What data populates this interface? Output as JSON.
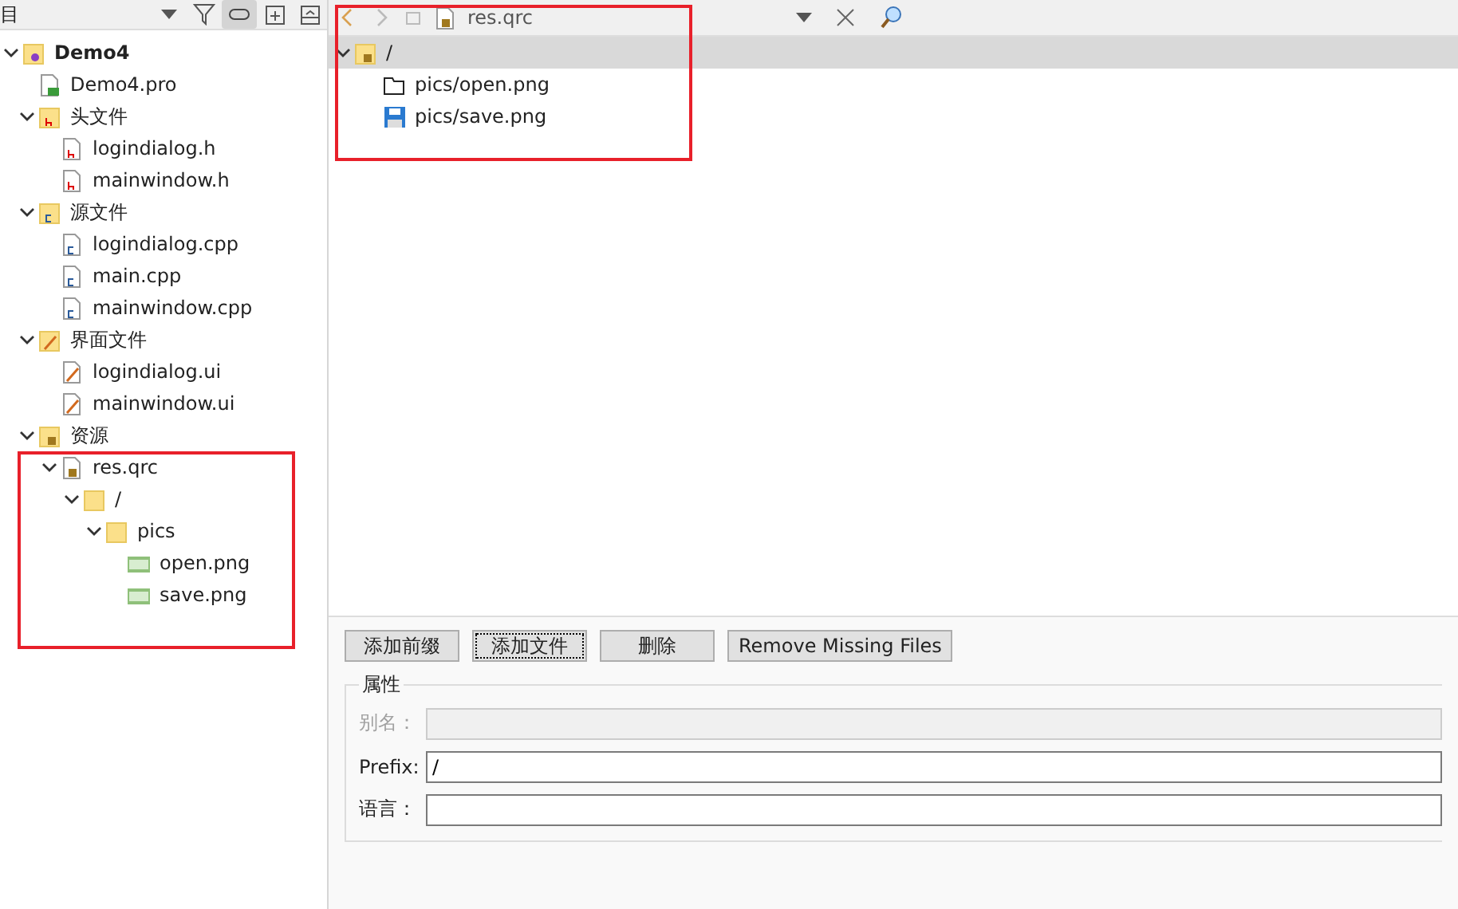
{
  "project_panel": {
    "title": "目",
    "tree": [
      {
        "label": "Demo4",
        "kind": "project",
        "expanded": true,
        "bold": true,
        "children": [
          {
            "label": "Demo4.pro",
            "kind": "pro"
          },
          {
            "label": "头文件",
            "kind": "folder-h",
            "expanded": true,
            "children": [
              {
                "label": "logindialog.h",
                "kind": "h"
              },
              {
                "label": "mainwindow.h",
                "kind": "h"
              }
            ]
          },
          {
            "label": "源文件",
            "kind": "folder-cpp",
            "expanded": true,
            "children": [
              {
                "label": "logindialog.cpp",
                "kind": "cpp"
              },
              {
                "label": "main.cpp",
                "kind": "cpp"
              },
              {
                "label": "mainwindow.cpp",
                "kind": "cpp"
              }
            ]
          },
          {
            "label": "界面文件",
            "kind": "folder-ui",
            "expanded": true,
            "children": [
              {
                "label": "logindialog.ui",
                "kind": "ui"
              },
              {
                "label": "mainwindow.ui",
                "kind": "ui"
              }
            ]
          },
          {
            "label": "资源",
            "kind": "folder-res",
            "expanded": true,
            "children": [
              {
                "label": "res.qrc",
                "kind": "qrc",
                "expanded": true,
                "children": [
                  {
                    "label": "/",
                    "kind": "folder",
                    "expanded": true,
                    "children": [
                      {
                        "label": "pics",
                        "kind": "folder",
                        "expanded": true,
                        "children": [
                          {
                            "label": "open.png",
                            "kind": "png"
                          },
                          {
                            "label": "save.png",
                            "kind": "png"
                          }
                        ]
                      }
                    ]
                  }
                ]
              }
            ]
          }
        ]
      }
    ]
  },
  "editor": {
    "file": "res.qrc",
    "resources": [
      {
        "label": "/",
        "kind": "prefix",
        "selected": true,
        "expanded": true,
        "children": [
          {
            "label": "pics/open.png",
            "kind": "open",
            "selected": false
          },
          {
            "label": "pics/save.png",
            "kind": "save",
            "selected": false
          }
        ]
      }
    ],
    "buttons": [
      {
        "label": "添加前缀",
        "focused": false
      },
      {
        "label": "添加文件",
        "focused": true
      },
      {
        "label": "删除",
        "focused": false
      },
      {
        "label": "Remove Missing Files",
        "focused": false
      }
    ],
    "properties": {
      "title": "属性",
      "fields": [
        {
          "label": "别名：",
          "disabled": true
        },
        {
          "label": "Prefix:",
          "value": "/",
          "disabled": false
        },
        {
          "label": "语言：",
          "disabled": false
        }
      ]
    }
  }
}
